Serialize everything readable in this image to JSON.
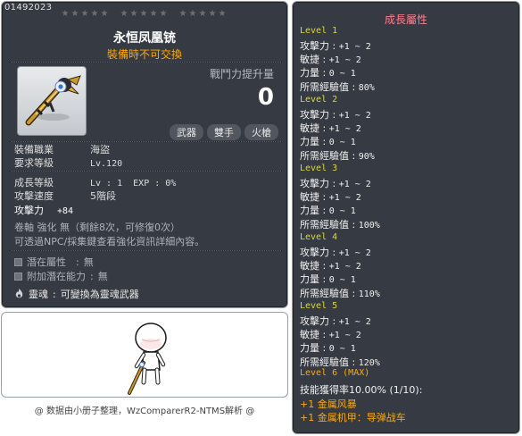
{
  "item": {
    "id": "01492023",
    "name": "永恒凤凰铳",
    "trade_note": "裝備時不可交換",
    "combat_power_label": "戰鬥力提升量",
    "combat_power_value": "0",
    "tags": [
      "武器",
      "雙手",
      "火槍"
    ],
    "stats": {
      "job_label": "裝備職業",
      "job_value": "海盜",
      "req_level_label": "要求等級",
      "req_level_value": "Lv.120",
      "growth_level_label": "成長等級",
      "growth_level_value": "Lv : 1  EXP : 0%",
      "attack_speed_label": "攻擊速度",
      "attack_speed_value": "5階段",
      "attack_label": "攻擊力",
      "attack_value": "+84"
    },
    "enhance_line1": "卷軸 強化 無（剩餘8次，可修復0次）",
    "enhance_line2": "可透過NPC/採集鍵查看強化資訊詳細內容。",
    "potential_label": "潛在屬性",
    "potential_value": "無",
    "additional_potential_label": "附加潛在能力",
    "additional_potential_value": "無",
    "soul_label": "靈魂",
    "soul_value": "可變換為靈魂武器",
    "stars_groups": 3,
    "stars_per_group": 5
  },
  "footer_note": "@ 数据由小册子整理，WzComparerR2-NTMS解析 @",
  "growth": {
    "title": "成長屬性",
    "levels": [
      {
        "header": "Level 1",
        "attack": "+1 ~ 2",
        "dex": "+1 ~ 2",
        "str": "0 ~ 1",
        "exp": "80%"
      },
      {
        "header": "Level 2",
        "attack": "+1 ~ 2",
        "dex": "+1 ~ 2",
        "str": "0 ~ 1",
        "exp": "90%"
      },
      {
        "header": "Level 3",
        "attack": "+1 ~ 2",
        "dex": "+1 ~ 2",
        "str": "0 ~ 1",
        "exp": "100%"
      },
      {
        "header": "Level 4",
        "attack": "+1 ~ 2",
        "dex": "+1 ~ 2",
        "str": "0 ~ 1",
        "exp": "110%"
      },
      {
        "header": "Level 5",
        "attack": "+1 ~ 2",
        "dex": "+1 ~ 2",
        "str": "0 ~ 1",
        "exp": "120%"
      }
    ],
    "label_attack": "攻擊力",
    "label_dex": "敏捷",
    "label_str": "力量",
    "label_exp": "所需經驗值",
    "max_header": "Level 6 (MAX)",
    "max_skill": "技能獲得率10.00% (1/10):",
    "max_skill_1": "+1 金属风暴",
    "max_skill_2": "+1 金属机甲：导弹战车"
  }
}
